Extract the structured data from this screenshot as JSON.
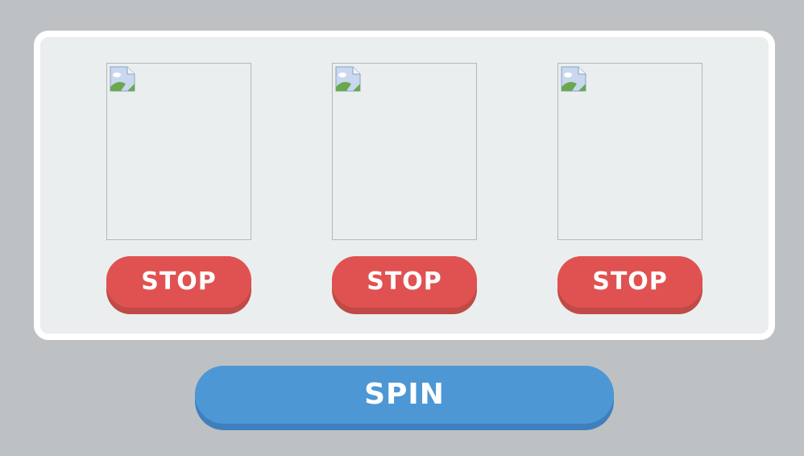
{
  "reels": [
    {
      "image_icon": "broken-image-icon",
      "stop_label": "STOP"
    },
    {
      "image_icon": "broken-image-icon",
      "stop_label": "STOP"
    },
    {
      "image_icon": "broken-image-icon",
      "stop_label": "STOP"
    }
  ],
  "spin_label": "SPIN",
  "colors": {
    "background": "#bdc1c4",
    "panel": "#ebeeee",
    "panel_border": "#ffffff",
    "stop_button": "#e05252",
    "stop_button_shadow": "#c04a45",
    "spin_button": "#4d97d5",
    "spin_button_shadow": "#3f7fbe",
    "button_text": "#ffffff"
  }
}
